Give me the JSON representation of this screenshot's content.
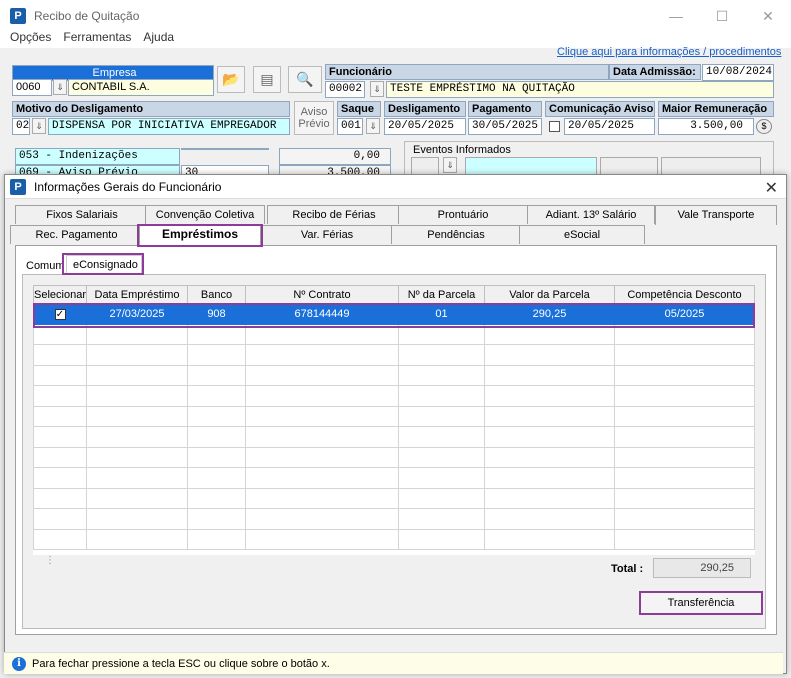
{
  "main": {
    "title": "Recibo de Quitação",
    "menu": [
      "Opções",
      "Ferramentas",
      "Ajuda"
    ],
    "info_link": "Clique aqui para informações / procedimentos",
    "empresa": {
      "label": "Empresa",
      "code": "0060",
      "name": "CONTABIL S.A."
    },
    "funcionario": {
      "label": "Funcionário",
      "code": "00002",
      "name": "TESTE EMPRÉSTIMO NA QUITAÇÃO"
    },
    "admissao": {
      "label": "Data Admissão:",
      "value": "10/08/2024"
    },
    "motivo": {
      "label": "Motivo do Desligamento",
      "code": "02",
      "value": "DISPENSA POR INICIATIVA EMPREGADOR"
    },
    "aviso_previo": {
      "line1": "Aviso",
      "line2": "Prévio"
    },
    "saque": {
      "label": "Saque",
      "value": "001"
    },
    "desligamento": {
      "label": "Desligamento",
      "value": "20/05/2025"
    },
    "pagamento": {
      "label": "Pagamento",
      "value": "30/05/2025"
    },
    "comunicacao": {
      "label": "Comunicação Aviso",
      "value": "20/05/2025"
    },
    "maior_rem": {
      "label": "Maior Remuneração",
      "value": "3.500,00"
    },
    "verbas": [
      {
        "label": "053 - Indenizações",
        "value": "0,00"
      },
      {
        "label": "069 - Aviso Prévio",
        "qty": "30",
        "value": "3.500,00"
      }
    ],
    "eventos_label": "Eventos Informados"
  },
  "modal": {
    "title": "Informações Gerais do Funcionário",
    "tabs_row1": [
      "Fixos Salariais",
      "Convenção Coletiva",
      "Recibo de Férias",
      "Prontuário",
      "Adiant. 13º Salário",
      "Vale Transporte"
    ],
    "tabs_row2": [
      "Rec. Pagamento",
      "Empréstimos",
      "Var. Férias",
      "Pendências",
      "eSocial"
    ],
    "subtabs": [
      "Comum",
      "eConsignado"
    ],
    "columns": [
      "Selecionar",
      "Data Empréstimo",
      "Banco",
      "Nº Contrato",
      "Nº da Parcela",
      "Valor da Parcela",
      "Competência Desconto"
    ],
    "rows": [
      {
        "check": "✓",
        "data": "27/03/2025",
        "banco": "908",
        "contrato": "678144449",
        "parcela": "01",
        "valor": "290,25",
        "competencia": "05/2025"
      }
    ],
    "total_label": "Total :",
    "total_value": "290,25",
    "transfer_button": "Transferência"
  },
  "status": "Para fechar pressione a tecla ESC ou clique sobre o botão x."
}
